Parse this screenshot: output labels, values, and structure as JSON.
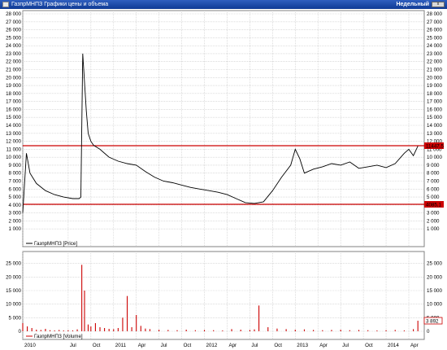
{
  "window": {
    "title": "ГазпрМНПЗ Графики цены и объема",
    "period_label": "Недельный",
    "close_label": "x"
  },
  "colors": {
    "price_line": "#000000",
    "volume_bar": "#cc0000",
    "level_line": "#cc0000",
    "grid": "#c8c8c8",
    "frame": "#808080"
  },
  "chart_data": [
    {
      "type": "line",
      "legend": "ГазпрМНПЗ [Price]",
      "ylim": [
        0,
        28000
      ],
      "y_ticks": [
        "1 000",
        "2 000",
        "3 000",
        "4 000",
        "5 000",
        "6 000",
        "7 000",
        "8 000",
        "9 000",
        "10 000",
        "11 000",
        "12 000",
        "13 000",
        "14 000",
        "15 000",
        "16 000",
        "17 000",
        "18 000",
        "19 000",
        "20 000",
        "21 000",
        "22 000",
        "23 000",
        "24 000",
        "25 000",
        "26 000",
        "27 000",
        "28 000"
      ],
      "levels": [
        {
          "value": 11447.5,
          "label": "11447,5"
        },
        {
          "value": 4085.1,
          "label": "4085,1"
        }
      ],
      "grid": true,
      "x": [
        2010.0,
        2010.04,
        2010.08,
        2010.15,
        2010.25,
        2010.35,
        2010.45,
        2010.55,
        2010.62,
        2010.64,
        2010.66,
        2010.7,
        2010.72,
        2010.75,
        2010.78,
        2010.85,
        2010.95,
        2011.05,
        2011.15,
        2011.25,
        2011.35,
        2011.45,
        2011.55,
        2011.65,
        2011.75,
        2011.85,
        2011.95,
        2012.05,
        2012.15,
        2012.25,
        2012.35,
        2012.45,
        2012.55,
        2012.65,
        2012.75,
        2012.85,
        2012.95,
        2013.0,
        2013.05,
        2013.1,
        2013.2,
        2013.3,
        2013.4,
        2013.5,
        2013.6,
        2013.7,
        2013.8,
        2013.9,
        2014.0,
        2014.1,
        2014.2,
        2014.25,
        2014.3,
        2014.35
      ],
      "y": [
        3000,
        10500,
        8000,
        6700,
        5800,
        5300,
        5000,
        4800,
        4800,
        5000,
        23000,
        15800,
        13000,
        12000,
        11500,
        11000,
        10000,
        9500,
        9200,
        9000,
        8200,
        7500,
        7000,
        6800,
        6500,
        6200,
        6000,
        5800,
        5600,
        5300,
        4800,
        4300,
        4200,
        4400,
        5800,
        7500,
        9000,
        11000,
        9800,
        8000,
        8500,
        8800,
        9200,
        9000,
        9400,
        8600,
        8800,
        9000,
        8700,
        9200,
        10500,
        11000,
        10200,
        11400
      ]
    },
    {
      "type": "bar",
      "legend": "ГазпрМНПЗ [Volume]",
      "ylim": [
        0,
        27000
      ],
      "y_ticks": [
        "0",
        "5 000",
        "10 000",
        "15 000",
        "20 000",
        "25 000"
      ],
      "last_label": "3 892",
      "x": [
        2010.0,
        2010.05,
        2010.1,
        2010.15,
        2010.2,
        2010.25,
        2010.3,
        2010.35,
        2010.4,
        2010.45,
        2010.5,
        2010.55,
        2010.6,
        2010.65,
        2010.68,
        2010.72,
        2010.75,
        2010.8,
        2010.85,
        2010.9,
        2010.95,
        2011.0,
        2011.05,
        2011.1,
        2011.15,
        2011.2,
        2011.25,
        2011.3,
        2011.35,
        2011.4,
        2011.5,
        2011.6,
        2011.7,
        2011.8,
        2011.9,
        2012.0,
        2012.1,
        2012.2,
        2012.3,
        2012.4,
        2012.5,
        2012.55,
        2012.6,
        2012.7,
        2012.8,
        2012.9,
        2013.0,
        2013.1,
        2013.2,
        2013.3,
        2013.4,
        2013.5,
        2013.6,
        2013.7,
        2013.8,
        2013.9,
        2014.0,
        2014.1,
        2014.2,
        2014.3,
        2014.35
      ],
      "values": [
        3000,
        1800,
        1200,
        600,
        500,
        900,
        400,
        300,
        500,
        300,
        400,
        300,
        700,
        24500,
        15000,
        2500,
        1800,
        3000,
        1500,
        1200,
        900,
        800,
        1200,
        5000,
        13000,
        1500,
        6000,
        2000,
        1000,
        800,
        600,
        500,
        400,
        600,
        400,
        500,
        400,
        300,
        800,
        600,
        500,
        700,
        9500,
        1500,
        1000,
        800,
        600,
        700,
        500,
        400,
        500,
        600,
        400,
        500,
        400,
        300,
        400,
        500,
        300,
        800,
        3892
      ]
    }
  ],
  "x_axis": {
    "start": 2010.0,
    "end": 2014.42,
    "ticks": [
      {
        "t": 2010.0,
        "label": "2010"
      },
      {
        "t": 2010.5,
        "label": "Jul"
      },
      {
        "t": 2010.75,
        "label": "Oct"
      },
      {
        "t": 2011.0,
        "label": "2011"
      },
      {
        "t": 2011.25,
        "label": "Apr"
      },
      {
        "t": 2011.5,
        "label": "Jul"
      },
      {
        "t": 2011.75,
        "label": "Oct"
      },
      {
        "t": 2012.0,
        "label": "2012"
      },
      {
        "t": 2012.25,
        "label": "Apr"
      },
      {
        "t": 2012.5,
        "label": "Jul"
      },
      {
        "t": 2012.75,
        "label": "Oct"
      },
      {
        "t": 2013.0,
        "label": "2013"
      },
      {
        "t": 2013.25,
        "label": "Apr"
      },
      {
        "t": 2013.5,
        "label": "Jul"
      },
      {
        "t": 2013.75,
        "label": "Oct"
      },
      {
        "t": 2014.0,
        "label": "2014"
      },
      {
        "t": 2014.25,
        "label": "Apr"
      }
    ]
  }
}
